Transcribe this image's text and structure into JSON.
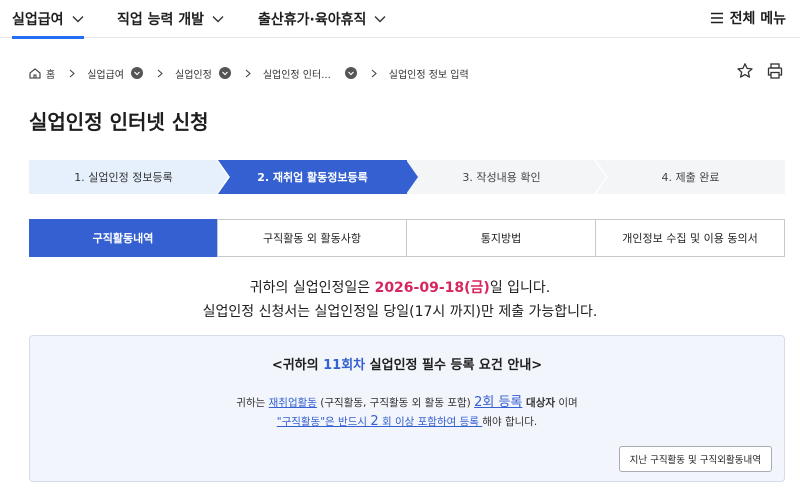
{
  "topnav": {
    "items": [
      {
        "label": "실업급여"
      },
      {
        "label": "직업 능력 개발"
      },
      {
        "label": "출산휴가·육아휴직"
      }
    ],
    "all_menu": "전체 메뉴"
  },
  "breadcrumb": {
    "home": "홈",
    "items": [
      "실업급여",
      "실업인정",
      "실업인정 인터...",
      "실업인정 정보 입력"
    ]
  },
  "page": {
    "title": "실업인정 인터넷 신청"
  },
  "steps": [
    {
      "label": "1. 실업인정 정보등록",
      "state": "done"
    },
    {
      "label": "2. 재취업 활동정보등록",
      "state": "current"
    },
    {
      "label": "3. 작성내용 확인",
      "state": "todo"
    },
    {
      "label": "4. 제출 완료",
      "state": "todo"
    }
  ],
  "tabs": [
    {
      "label": "구직활동내역",
      "active": true
    },
    {
      "label": "구직활동 외 활동사항"
    },
    {
      "label": "통지방법"
    },
    {
      "label": "개인정보 수집 및 이용 동의서"
    }
  ],
  "notice": {
    "line1_prefix": "귀하의 실업인정일은 ",
    "date": "2026-09-18(금)",
    "line1_suffix": "일 입니다.",
    "line2": "실업인정 신청서는 실업인정일 당일(17시 까지)만 제출 가능합니다."
  },
  "info": {
    "title_prefix": "<귀하의 ",
    "title_num": "11회차",
    "title_suffix": " 실업인정 필수 등록 요건 안내>",
    "l1_a": "귀하는 ",
    "l1_link": "재취업활동",
    "l1_b": " (구직활동, 구직활동 외 활동 포함) ",
    "l1_count": "2회 등록",
    "l1_c": " 대상자",
    "l1_d": " 이며",
    "l2_link1": "\"구직활동\"은 반드시 ",
    "l2_num": "2",
    "l2_link2": " 회 이상 포함하여 등록 ",
    "l2_tail": "해야 합니다.",
    "history_button": "지난 구직활동 및 구직외활동내역"
  },
  "colors": {
    "accent": "#3460d1",
    "date": "#d6265d",
    "step_done_bg": "#e6f0fd",
    "step_todo_bg": "#f4f5f7",
    "info_bg": "#f2f5fb"
  }
}
